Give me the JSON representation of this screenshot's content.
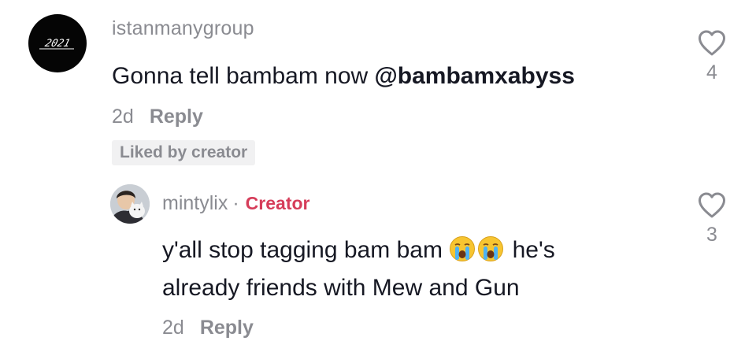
{
  "comment": {
    "username": "istanmanygroup",
    "avatar_logo_text": "2021",
    "text_before_mention": "Gonna tell bambam now ",
    "mention": "@bambamxabyss",
    "date": "2d",
    "reply_label": "Reply",
    "liked_badge": "Liked by creator",
    "likes": "4",
    "like_icon": "heart-outline-icon"
  },
  "reply": {
    "username": "mintylix",
    "separator": "·",
    "creator_badge": "Creator",
    "line1_before_emoji": "y'all stop tagging bam bam ",
    "emojis": [
      "crying-face-emoji",
      "crying-face-emoji"
    ],
    "line1_after_emoji": " he's",
    "line2": "already friends with Mew and Gun",
    "date": "2d",
    "reply_label": "Reply",
    "likes": "3",
    "like_icon": "heart-outline-icon"
  },
  "colors": {
    "text": "#161823",
    "muted": "#8a8b91",
    "creator": "#d63d5a",
    "badge_bg": "#f1f1f2"
  }
}
